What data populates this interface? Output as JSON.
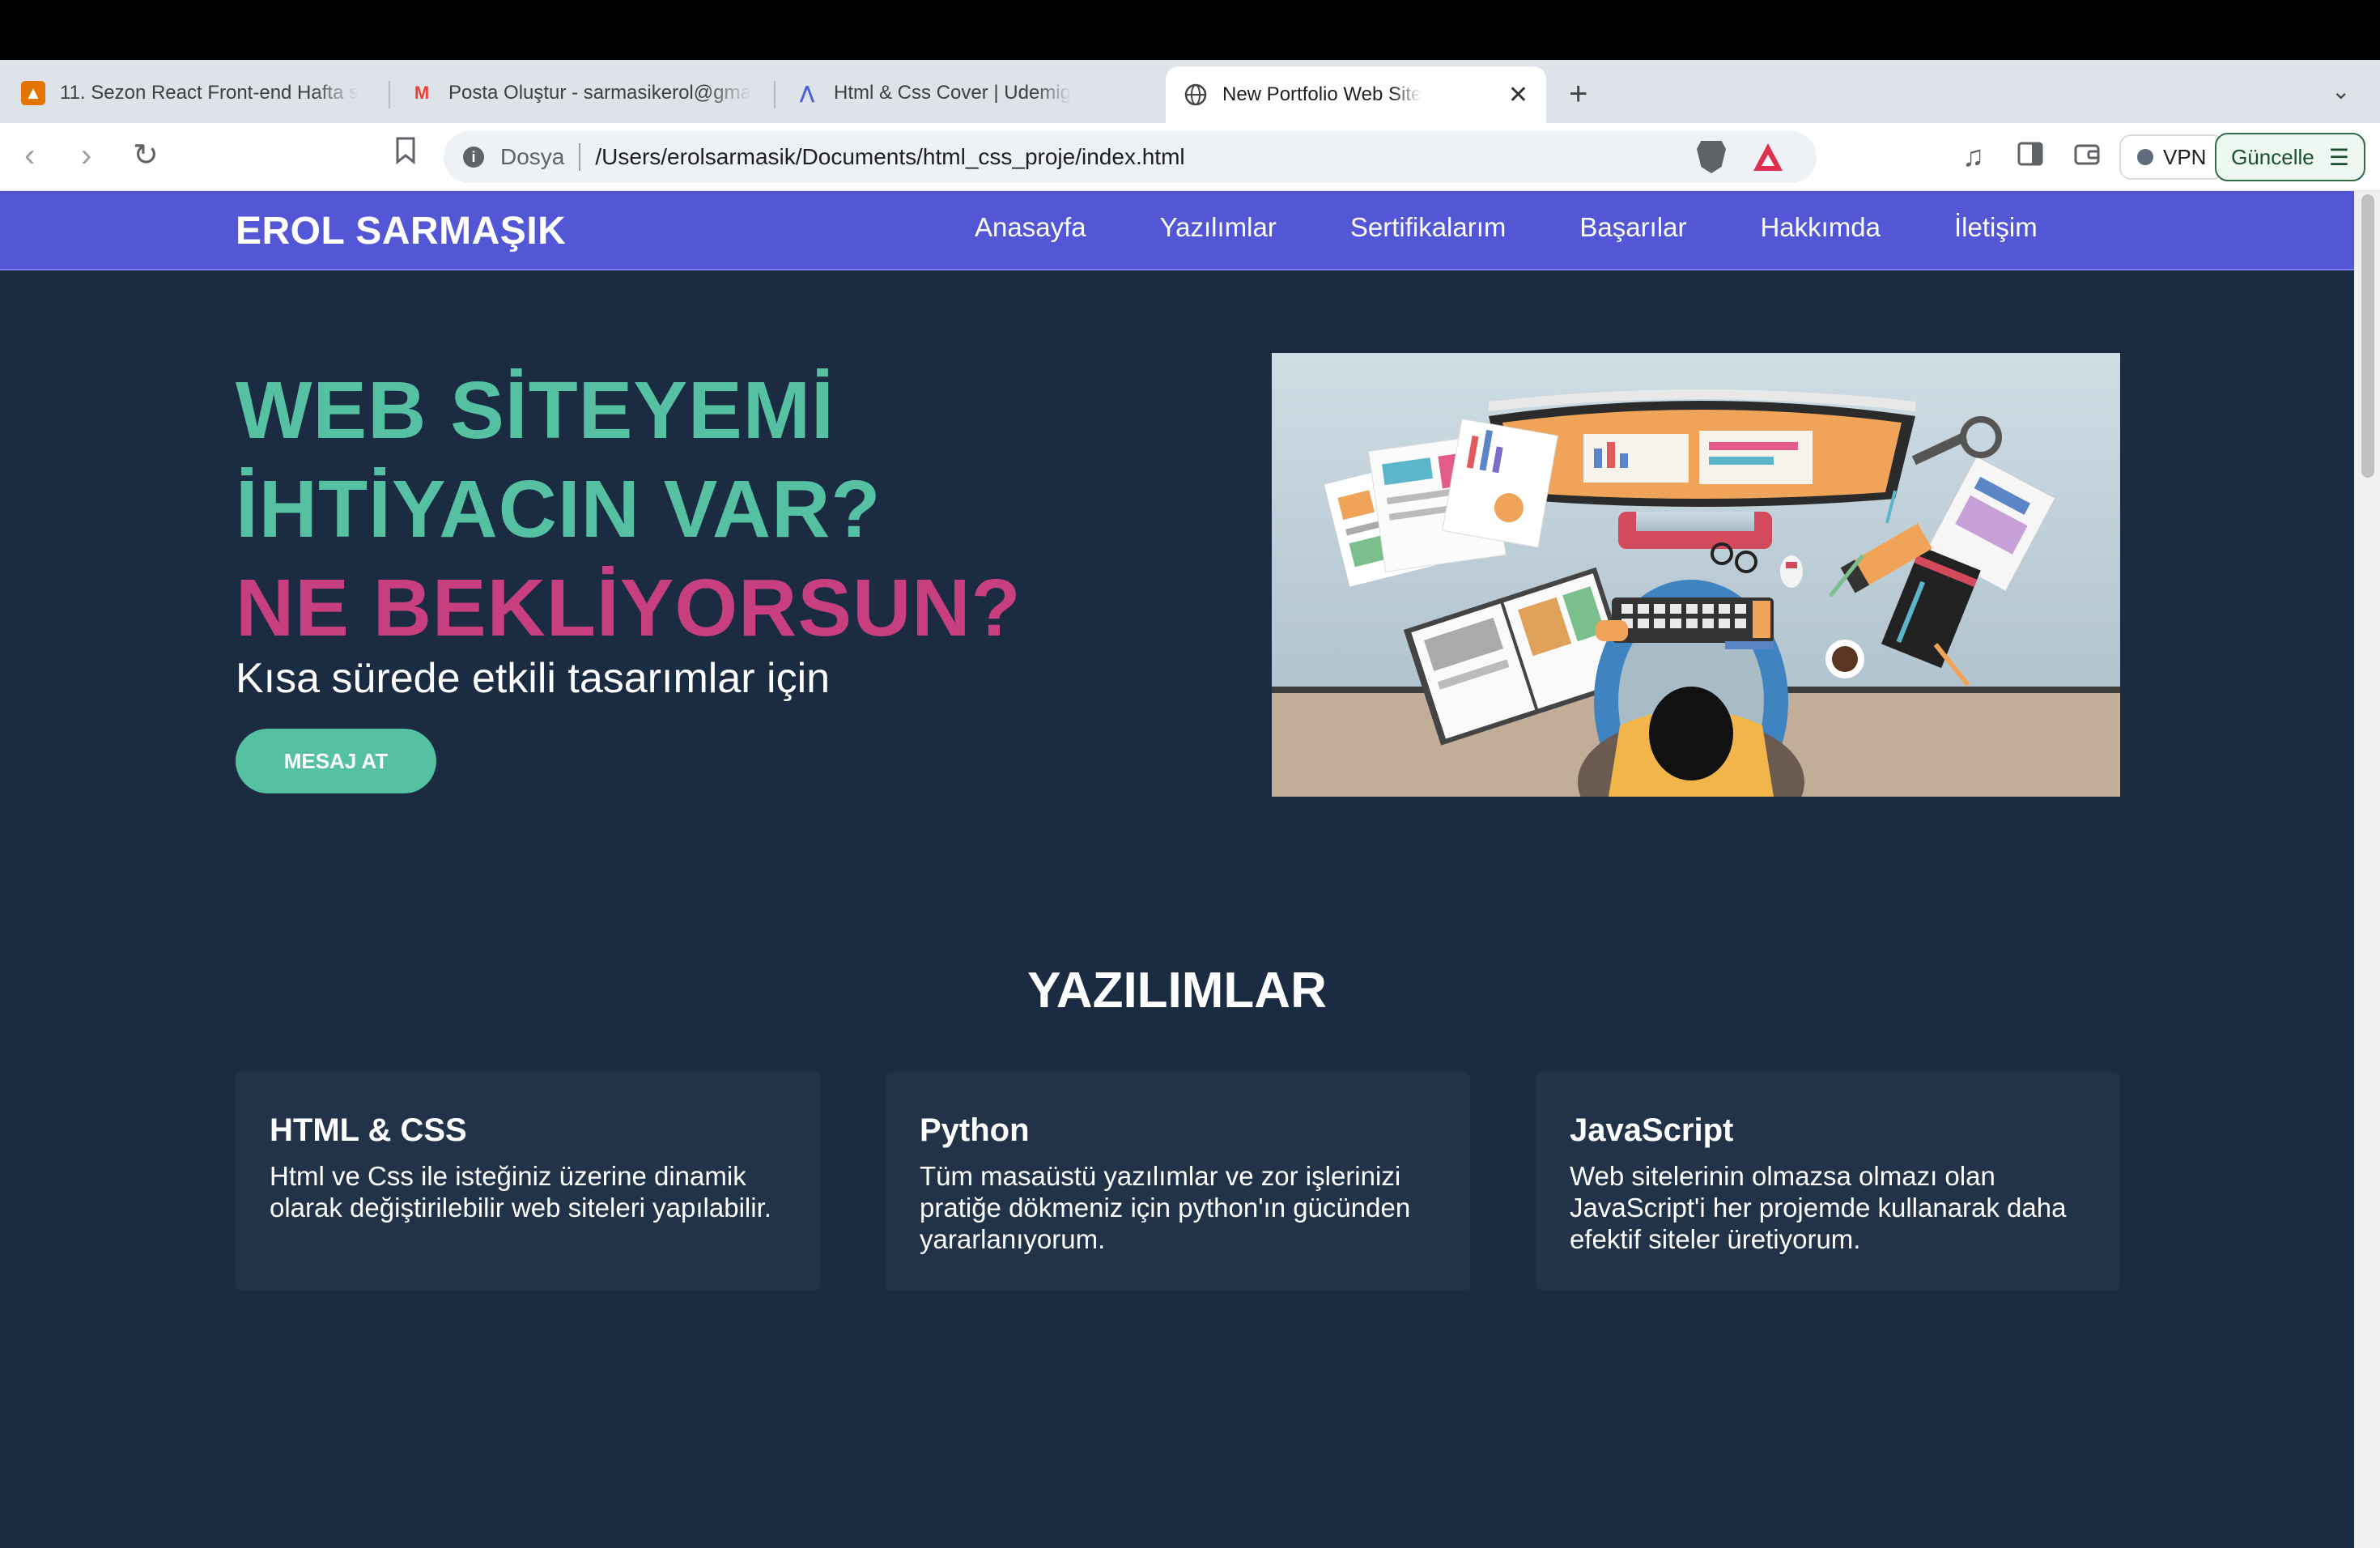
{
  "browser": {
    "tabs": [
      {
        "label": "11. Sezon React Front-end Hafta s",
        "icon": "classroom-icon",
        "color": "#e37400"
      },
      {
        "label": "Posta Oluştur - sarmasikerol@gma",
        "icon": "gmail-icon",
        "color": "#ea4335"
      },
      {
        "label": "Html & Css Cover | Udemig",
        "icon": "udemig-icon",
        "color": "#4a5fd8"
      },
      {
        "label": "New Portfolio Web Site",
        "icon": "globe-icon",
        "active": true
      }
    ],
    "address": {
      "scheme_label": "Dosya",
      "url": "/Users/erolsarmasik/Documents/html_css_proje/index.html"
    },
    "vpn_label": "VPN",
    "update_label": "Güncelle"
  },
  "site": {
    "brand": "EROL SARMAŞIK",
    "menu": [
      "Anasayfa",
      "Yazılımlar",
      "Sertifikalarım",
      "Başarılar",
      "Hakkımda",
      "İletişim"
    ],
    "hero": {
      "line1": "WEB SİTEYEMİ",
      "line2": "İHTİYACIN VAR?",
      "line3": "NE BEKLİYORSUN?",
      "subtitle": "Kısa sürede etkili tasarımlar için",
      "cta": "MESAJ AT"
    },
    "section_title": "YAZILIMLAR",
    "cards": [
      {
        "title": "HTML & CSS",
        "text": "Html ve Css ile isteğiniz üzerine dinamik olarak değiştirilebilir web siteleri yapılabilir."
      },
      {
        "title": "Python",
        "text": "Tüm masaüstü yazılımlar ve zor işlerinizi pratiğe dökmeniz için python'ın gücünden yararlanıyorum."
      },
      {
        "title": "JavaScript",
        "text": "Web sitelerinin olmazsa olmazı olan JavaScript'i her projemde kullanarak daha efektif siteler üretiyorum."
      }
    ],
    "colors": {
      "nav": "#5357d6",
      "accent_teal": "#55c0a2",
      "accent_pink": "#c73f7f",
      "background": "#1a2b42",
      "card": "#223349"
    }
  }
}
